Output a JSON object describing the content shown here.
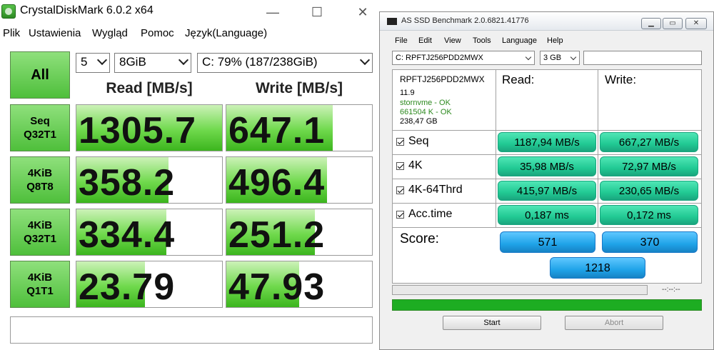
{
  "cdm": {
    "title": "CrystalDiskMark 6.0.2 x64",
    "controls": {
      "minimize": "—",
      "maximize": "☐",
      "close": "✕"
    },
    "menu": [
      "Plik",
      "Ustawienia",
      "Wygląd",
      "Pomoc",
      "Język(Language)"
    ],
    "all_label": "All",
    "count_value": "5",
    "size_value": "8GiB",
    "drive_value": "C: 79% (187/238GiB)",
    "read_header": "Read [MB/s]",
    "write_header": "Write [MB/s]",
    "rows": [
      {
        "label1": "Seq",
        "label2": "Q32T1",
        "read": "1305.7",
        "write": "647.1",
        "read_fill": 1.0,
        "write_fill": 0.73
      },
      {
        "label1": "4KiB",
        "label2": "Q8T8",
        "read": "358.2",
        "write": "496.4",
        "read_fill": 0.63,
        "write_fill": 0.69
      },
      {
        "label1": "4KiB",
        "label2": "Q32T1",
        "read": "334.4",
        "write": "251.2",
        "read_fill": 0.62,
        "write_fill": 0.61
      },
      {
        "label1": "4KiB",
        "label2": "Q1T1",
        "read": "23.79",
        "write": "47.93",
        "read_fill": 0.47,
        "write_fill": 0.5
      }
    ],
    "comment": ""
  },
  "asssd": {
    "title": "AS SSD Benchmark 2.0.6821.41776",
    "controls": {
      "minimize": "▁",
      "restore": "▭",
      "close": "✕"
    },
    "menu": [
      "File",
      "Edit",
      "View",
      "Tools",
      "Language",
      "Help"
    ],
    "drive_select": "C: RPFTJ256PDD2MWX",
    "size_select": "3 GB",
    "info": {
      "model": "RPFTJ256PDD2MWX",
      "firmware": "11.9",
      "driver": "stornvme - OK",
      "alignment": "661504 K - OK",
      "capacity": "238,47 GB"
    },
    "read_header": "Read:",
    "write_header": "Write:",
    "rows": [
      {
        "label": "Seq",
        "read": "1187,94 MB/s",
        "write": "667,27 MB/s"
      },
      {
        "label": "4K",
        "read": "35,98 MB/s",
        "write": "72,97 MB/s"
      },
      {
        "label": "4K-64Thrd",
        "read": "415,97 MB/s",
        "write": "230,65 MB/s"
      },
      {
        "label": "Acc.time",
        "read": "0,187 ms",
        "write": "0,172 ms"
      }
    ],
    "score_label": "Score:",
    "score_read": "571",
    "score_write": "370",
    "score_total": "1218",
    "time_text": "--:--:--",
    "progress": 1.0,
    "start_label": "Start",
    "abort_label": "Abort",
    "colors": {
      "result": "#21c993",
      "score": "#1fa3e8",
      "progress": "#1dad22"
    }
  }
}
